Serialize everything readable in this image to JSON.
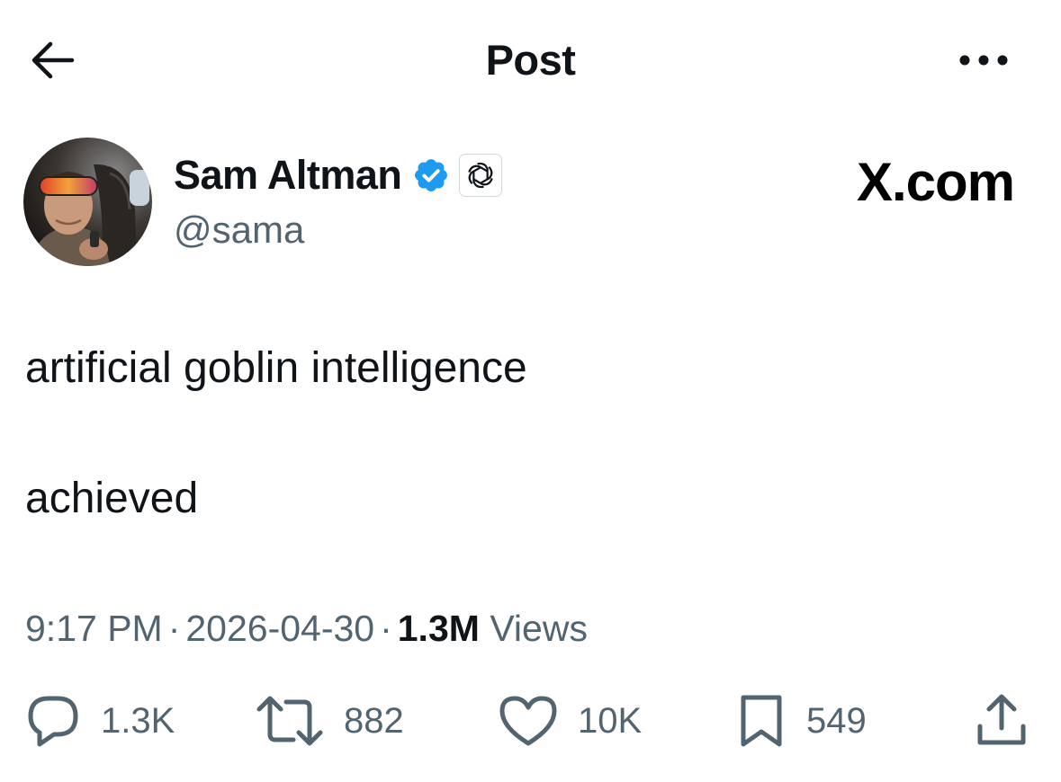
{
  "header": {
    "title": "Post"
  },
  "author": {
    "display_name": "Sam Altman",
    "handle": "@sama",
    "verified": true,
    "affiliate_badge": "openai-logo-icon"
  },
  "watermark": "X.com",
  "tweet": {
    "lines": [
      "artificial goblin intelligence",
      "achieved"
    ]
  },
  "meta": {
    "time": "9:17 PM",
    "date": "2026-04-30",
    "views_count": "1.3M",
    "views_label": "Views",
    "separator": "·"
  },
  "actions": {
    "replies": "1.3K",
    "reposts": "882",
    "likes": "10K",
    "bookmarks": "549"
  },
  "colors": {
    "text_primary": "#0f1419",
    "text_secondary": "#536471",
    "verified_blue": "#1d9bf0",
    "background": "#ffffff"
  }
}
